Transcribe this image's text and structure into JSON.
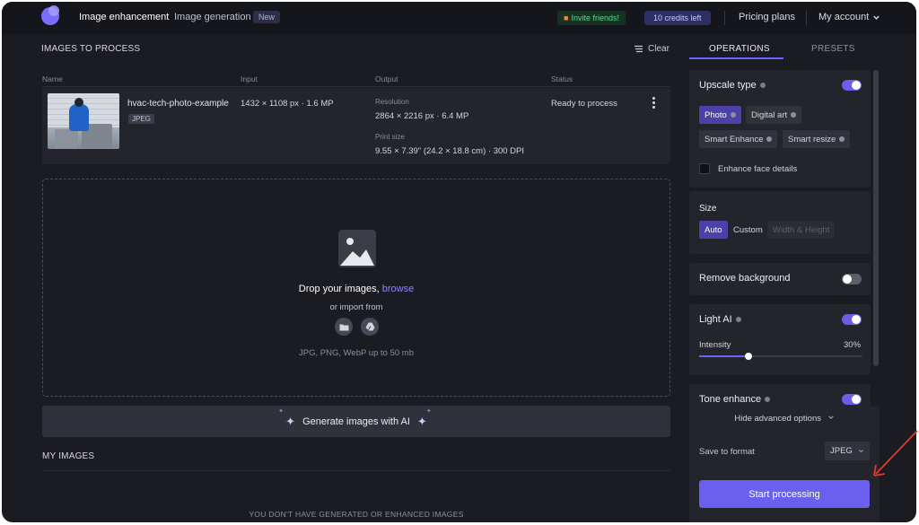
{
  "topbar": {
    "nav": [
      "Image enhancement",
      "Image generation"
    ],
    "new_badge": "New",
    "invite": "Invite friends!",
    "credits": "10 credits left",
    "pricing": "Pricing plans",
    "account": "My account"
  },
  "images": {
    "section_title": "IMAGES TO PROCESS",
    "clear_label": "Clear",
    "columns": [
      "Name",
      "Input",
      "Output",
      "Status"
    ],
    "row": {
      "name": "hvac-tech-photo-example",
      "type": "JPEG",
      "input": "1432 × 1108 px · 1.6 MP",
      "resolution_label": "Resolution",
      "resolution": "2864 × 2216 px · 6.4 MP",
      "print_label": "Print size",
      "print": "9.55 × 7.39\" (24.2 × 18.8 cm) · 300 DPI",
      "status": "Ready to process"
    }
  },
  "dropzone": {
    "title": "Drop your images,",
    "browse": "browse",
    "import_from": "or import from",
    "formats": "JPG, PNG, WebP up to 50 mb"
  },
  "generate_label": "Generate images with AI",
  "my_images": {
    "title": "MY IMAGES",
    "empty": "YOU DON'T HAVE GENERATED OR ENHANCED IMAGES"
  },
  "panel": {
    "tabs": [
      "OPERATIONS",
      "PRESETS"
    ],
    "upscale": {
      "title": "Upscale type",
      "enabled": true,
      "types": [
        "Photo",
        "Digital art",
        "Smart Enhance",
        "Smart resize"
      ],
      "selected": "Photo",
      "face_label": "Enhance face details"
    },
    "size": {
      "title": "Size",
      "options": [
        "Auto",
        "Custom",
        "Width & Height"
      ],
      "selected": "Auto"
    },
    "remove_bg": {
      "title": "Remove background",
      "enabled": false
    },
    "light_ai": {
      "title": "Light AI",
      "enabled": true,
      "intensity_label": "Intensity",
      "intensity": "30%",
      "intensity_value": 30
    },
    "tone": {
      "title": "Tone enhance",
      "enabled": true
    },
    "advanced": "Hide advanced options",
    "save_label": "Save to format",
    "format": "JPEG",
    "start": "Start processing"
  },
  "colors": {
    "accent": "#6b5ff0",
    "background": "#1b1c22",
    "card": "#24252c",
    "annotation_arrow": "#e03a2f"
  }
}
